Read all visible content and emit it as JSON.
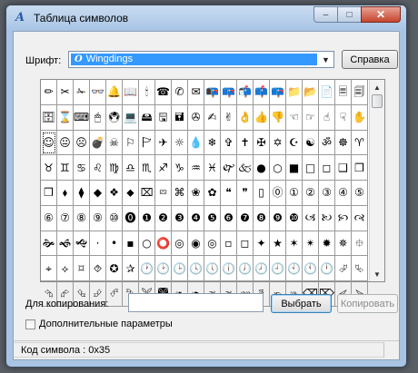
{
  "window": {
    "title": "Таблица символов",
    "title_icon": "charmap-icon"
  },
  "caption": {
    "minimize": "–",
    "maximize": "□",
    "close": "✕"
  },
  "font": {
    "label": "Шрифт:",
    "selected": "Wingdings",
    "font_icon": "opentype-font-icon"
  },
  "buttons": {
    "help": "Справка",
    "choose": "Выбрать",
    "copy": "Копировать"
  },
  "copy_field": {
    "label": "Для копирования:",
    "value": ""
  },
  "advanced": {
    "label": "Дополнительные параметры",
    "checked": false
  },
  "status": {
    "text": "Код символа : 0x35"
  },
  "grid": {
    "selected_index": 40,
    "scroll_position": 0,
    "rows": [
      [
        "✏",
        "✂",
        "✁",
        "👓",
        "🔔",
        "📖",
        "🕯",
        "☎",
        "✆",
        "✉",
        "📭",
        "📪",
        "📬",
        "📫",
        "📪",
        "📁",
        "📂",
        "📄",
        "🗏",
        "🗐"
      ],
      [
        "🗄",
        "⌛",
        "⌨",
        "🖱",
        "🖲",
        "💻",
        "🖴",
        "🖫",
        "🖬",
        "✇",
        "✍",
        "✌",
        "👌",
        "👍",
        "👎",
        "☜",
        "☞",
        "☝",
        "☟",
        "✋"
      ],
      [
        "☺",
        "😐",
        "☹",
        "💣",
        "☠",
        "⚐",
        "🏱",
        "✈",
        "☼",
        "💧",
        "❄",
        "✞",
        "✝",
        "✠",
        "✡",
        "☪",
        "☯",
        "ॐ",
        "☸",
        "♈"
      ],
      [
        "♉",
        "♊",
        "♋",
        "♌",
        "♍",
        "♎",
        "♏",
        "♐",
        "♑",
        "♒",
        "♓",
        "🙰",
        "🙵",
        "●",
        "○",
        "■",
        "□",
        "◻",
        "❑",
        "❒"
      ],
      [
        "❒",
        "⬧",
        "⧫",
        "◆",
        "❖",
        "⬥",
        "⌧",
        "⮹",
        "⌘",
        "❀",
        "✿",
        "❝",
        "❞",
        "▯",
        "⓪",
        "①",
        "②",
        "③",
        "④",
        "⑤"
      ],
      [
        "⑥",
        "⑦",
        "⑧",
        "⑨",
        "⑩",
        "⓿",
        "❶",
        "❷",
        "❸",
        "❹",
        "❺",
        "❻",
        "❼",
        "❽",
        "❾",
        "❿",
        "🙢",
        "🙠",
        "🙡",
        "🙣"
      ],
      [
        "🙞",
        "🙜",
        "🙝",
        "·",
        "•",
        "▪",
        "○",
        "⭕",
        "◎",
        "◉",
        "◎",
        "▫",
        "◻",
        "✦",
        "★",
        "✶",
        "✴",
        "✹",
        "✵",
        "⯐"
      ],
      [
        "⌖",
        "⟡",
        "⌑",
        "⯑",
        "✪",
        "✰",
        "🕐",
        "🕑",
        "🕒",
        "🕓",
        "🕔",
        "🕕",
        "🕖",
        "🕗",
        "🕘",
        "🕙",
        "🕚",
        "🕛",
        "⮰",
        "⮱"
      ],
      [
        "⮲",
        "⮳",
        "⮴",
        "⮵",
        "⮶",
        "⮷",
        "🙪",
        "🙫",
        "🙕",
        "🙔",
        "🙗",
        "🙖",
        "🙐",
        "🙑",
        "🙒",
        "🙓",
        "⌫",
        "⌦",
        "⮘",
        "⮚"
      ]
    ]
  }
}
